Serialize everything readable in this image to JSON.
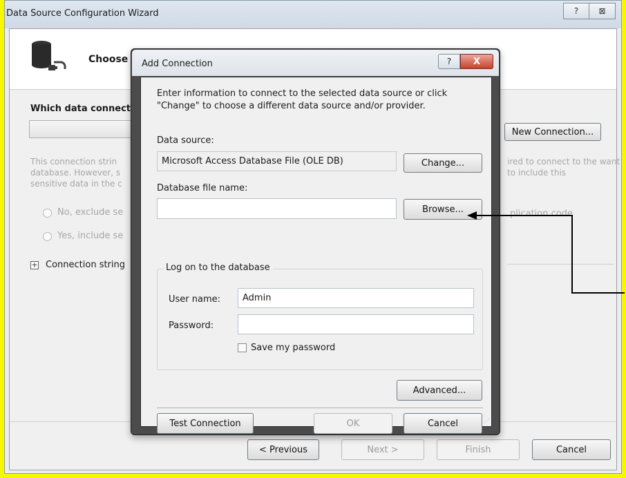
{
  "outer": {
    "title": "Data Source Configuration Wizard",
    "help_glyph": "?",
    "close_glyph": "⊠",
    "header_title": "Choose",
    "which_label": "Which data connecti",
    "new_connection": "New Connection...",
    "note_left": "This connection strin database. However, s sensitive data in the c",
    "note_right": "ired to connect to the want to include this",
    "radio_no": "No, exclude se",
    "radio_yes": "Yes, include se",
    "right_faint": "plication code",
    "expand_label": "Connection string",
    "expand_glyph": "+",
    "btn_previous": "< Previous",
    "btn_next": "Next >",
    "btn_finish": "Finish",
    "btn_cancel": "Cancel"
  },
  "dialog": {
    "title": "Add Connection",
    "help_glyph": "?",
    "close_glyph": "X",
    "intro_line1": "Enter information to connect to the selected data source or click",
    "intro_line2": "\"Change\" to choose a different data source and/or provider.",
    "data_source_label": "Data source:",
    "data_source_value": "Microsoft Access Database File (OLE DB)",
    "change_button": "Change...",
    "db_file_label": "Database file name:",
    "db_file_value": "",
    "browse_button": "Browse...",
    "logon_legend": "Log on to the database",
    "username_label": "User name:",
    "username_value": "Admin",
    "password_label": "Password:",
    "password_value": "",
    "save_password": "Save my password",
    "advanced_button": "Advanced...",
    "test_button": "Test Connection",
    "ok_button": "OK",
    "cancel_button": "Cancel",
    "grip": "⋰"
  },
  "annotation": {
    "arrow_color": "#000000"
  }
}
